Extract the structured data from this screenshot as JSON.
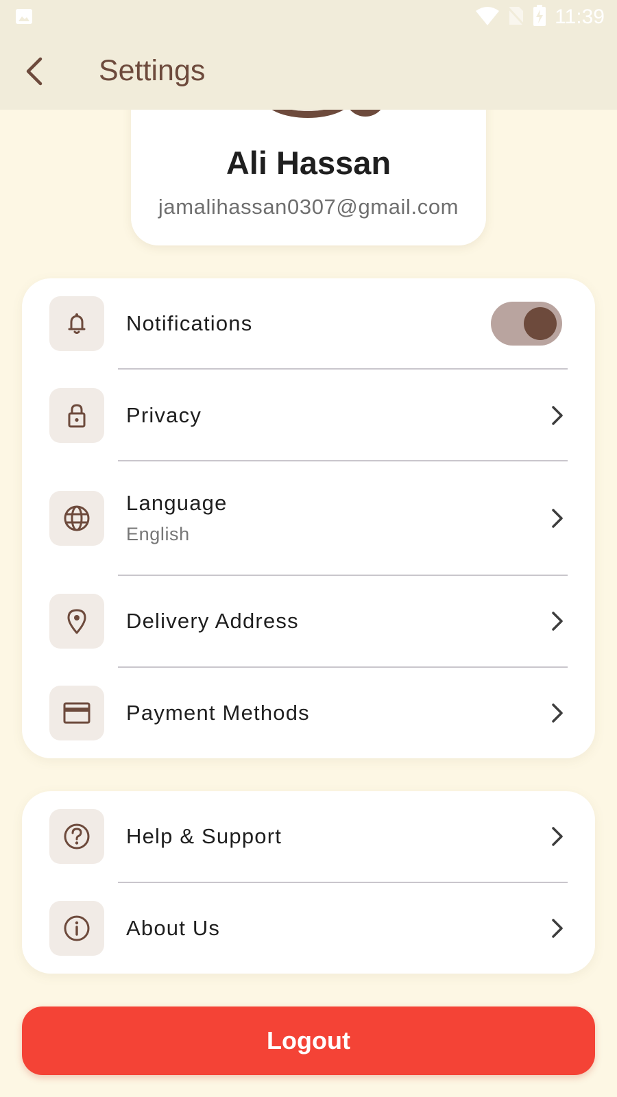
{
  "status_bar": {
    "time": "11:39",
    "icons": [
      "image-icon",
      "wifi-icon",
      "no-sim-icon",
      "battery-charging-icon"
    ]
  },
  "app_bar": {
    "title": "Settings",
    "back_icon": "arrow-back-icon"
  },
  "profile": {
    "name": "Ali Hassan",
    "email": "jamalihassan0307@gmail.com"
  },
  "settings": {
    "notifications": {
      "label": "Notifications",
      "icon": "bell-icon",
      "enabled": true
    },
    "privacy": {
      "label": "Privacy",
      "icon": "lock-icon"
    },
    "language": {
      "label": "Language",
      "value": "English",
      "icon": "globe-icon"
    },
    "delivery_address": {
      "label": "Delivery Address",
      "icon": "location-pin-icon"
    },
    "payment_methods": {
      "label": "Payment Methods",
      "icon": "credit-card-icon"
    }
  },
  "support": {
    "help": {
      "label": "Help & Support",
      "icon": "help-circle-icon"
    },
    "about": {
      "label": "About Us",
      "icon": "info-icon"
    }
  },
  "logout_label": "Logout",
  "colors": {
    "accent": "#6d4a3c",
    "background": "#fdf7e4",
    "appbar": "#f1ecda",
    "logout": "#f44336",
    "toggle_track": "#b9a49f"
  }
}
